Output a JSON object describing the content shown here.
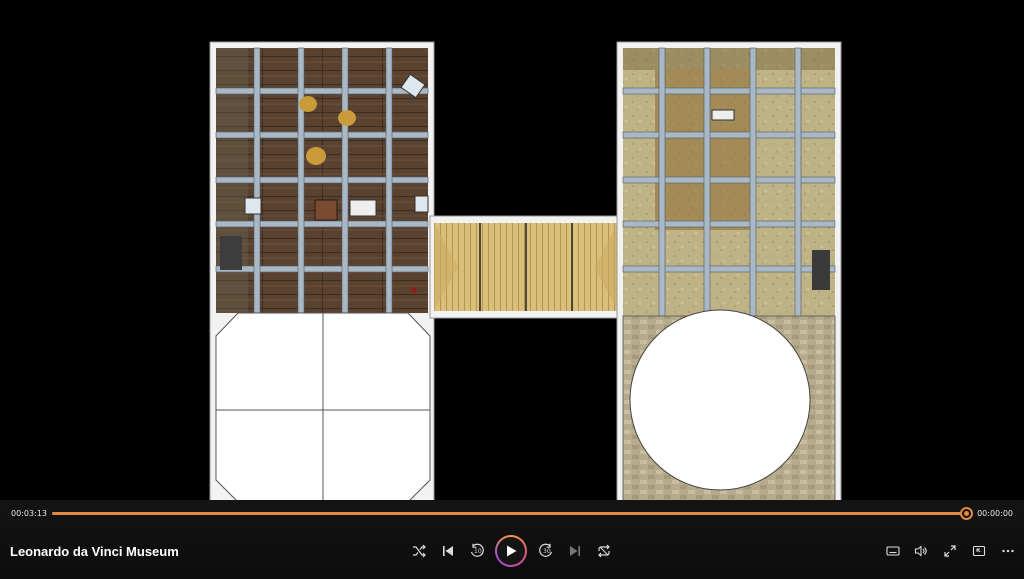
{
  "player": {
    "title": "Leonardo da Vinci Museum",
    "elapsed": "00:03:13",
    "remaining": "00:00:00",
    "progress": 1.0,
    "skip_back_seconds": "10",
    "skip_forward_seconds": "30",
    "accent": "#e08a43"
  },
  "icons": {
    "shuffle": "shuffle-icon",
    "previous": "previous-track-icon",
    "skip_back": "skip-back-10-icon",
    "play": "play-icon",
    "skip_forward": "skip-forward-30-icon",
    "next": "next-track-icon",
    "repeat": "repeat-icon",
    "subtitles": "subtitles-icon",
    "volume": "volume-icon",
    "fullscreen": "fullscreen-icon",
    "mini_player": "mini-player-icon",
    "more": "more-options-icon"
  }
}
